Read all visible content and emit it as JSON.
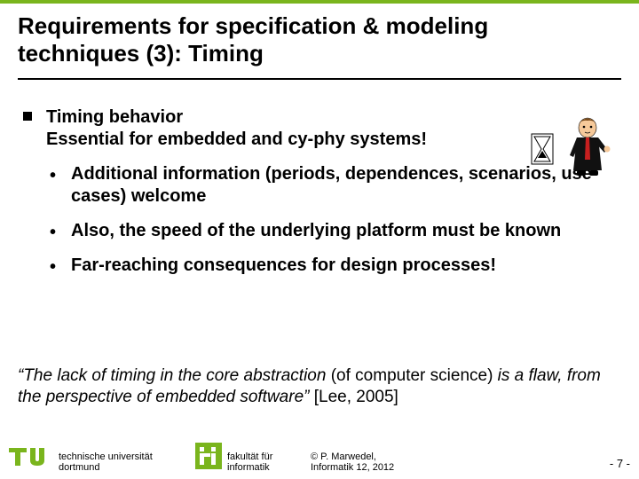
{
  "title": "Requirements for specification & modeling techniques (3): Timing",
  "bullets": {
    "main_line1": "Timing behavior",
    "main_line2": "Essential for embedded and cy-phy systems!",
    "sub1": "Additional information (periods, dependences, scenarios, use cases) welcome",
    "sub2": "Also, the speed of the underlying platform must be known",
    "sub3": "Far-reaching consequences for design processes!"
  },
  "quote": {
    "part1": "“The lack of timing in the core abstraction ",
    "part2": "(of computer science)",
    "part3": " is a flaw, from the perspective of embedded software”",
    "cite": " [Lee, 2005]"
  },
  "footer": {
    "uni_line1": "technische universität",
    "uni_line2": "dortmund",
    "fac_line1": "fakultät für",
    "fac_line2": "informatik",
    "copy_line1": "© P. Marwedel,",
    "copy_line2": "Informatik 12,  2012",
    "page": "-  7 -"
  },
  "colors": {
    "accent": "#7ab51d"
  }
}
